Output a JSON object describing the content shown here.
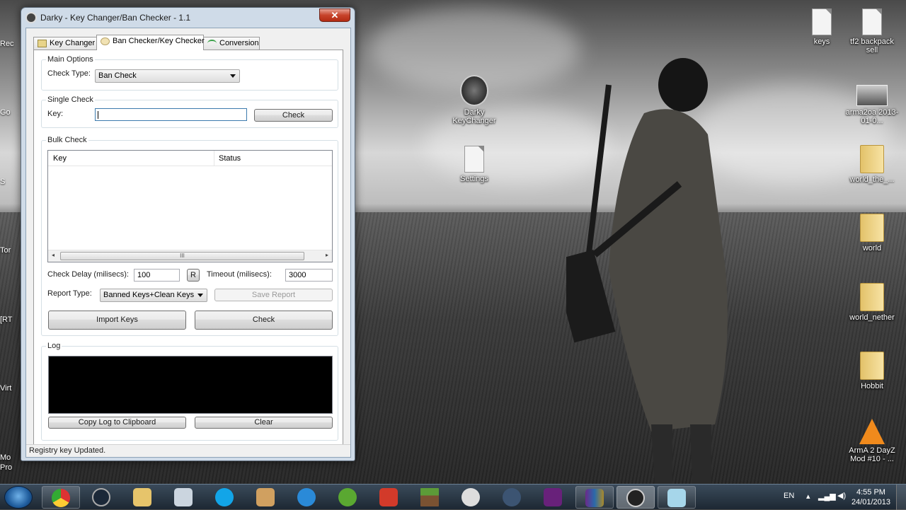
{
  "window": {
    "title": "Darky - Key Changer/Ban Checker - 1.1",
    "close_label": "✕"
  },
  "tabs": [
    {
      "label": "Key Changer"
    },
    {
      "label": "Ban Checker/Key Checker"
    },
    {
      "label": "Conversion"
    }
  ],
  "main_options": {
    "title": "Main Options",
    "check_type_label": "Check Type:",
    "check_type_value": "Ban Check"
  },
  "single_check": {
    "title": "Single Check",
    "key_label": "Key:",
    "key_value": "",
    "check_button": "Check"
  },
  "bulk_check": {
    "title": "Bulk Check",
    "columns": [
      "Key",
      "Status"
    ],
    "scroll_grip": "III",
    "check_delay_label": "Check Delay (milisecs):",
    "check_delay_value": "100",
    "reset_button": "R",
    "timeout_label": "Timeout (milisecs):",
    "timeout_value": "3000",
    "report_type_label": "Report Type:",
    "report_type_value": "Banned Keys+Clean Keys",
    "save_report_button": "Save Report",
    "import_keys_button": "Import Keys",
    "check_button": "Check"
  },
  "log": {
    "title": "Log",
    "copy_button": "Copy Log to Clipboard",
    "clear_button": "Clear"
  },
  "status_text": "Registry key Updated.",
  "desktop_icons": [
    {
      "label": "keys"
    },
    {
      "label": "tf2 backpack sell"
    },
    {
      "label": "Darky KeyChanger"
    },
    {
      "label": "arma2oa 2013-01-0..."
    },
    {
      "label": "Settings"
    },
    {
      "label": "world_the_..."
    },
    {
      "label": "world"
    },
    {
      "label": "world_nether"
    },
    {
      "label": "Hobbit"
    },
    {
      "label": "ArmA 2 DayZ Mod #10 - ..."
    }
  ],
  "left_clipped_labels": [
    "Rec",
    "Go",
    "S",
    "Tor",
    "[RT",
    "Virt",
    "Mo",
    "Pro"
  ],
  "taskbar": {
    "language": "EN",
    "time": "4:55 PM",
    "date": "24/01/2013",
    "items": [
      "chrome",
      "steam",
      "explorer",
      "taskmgr",
      "skype",
      "editor",
      "network",
      "utorrent",
      "ccleaner",
      "minecraft",
      "settings",
      "teamspeak",
      "visualstudio",
      "winrar",
      "darky",
      "notepad"
    ]
  },
  "colors": {
    "window_frame": "#cfdbe8",
    "close_button": "#c7432b",
    "log_background": "#000000",
    "taskbar": "#1d2833"
  }
}
